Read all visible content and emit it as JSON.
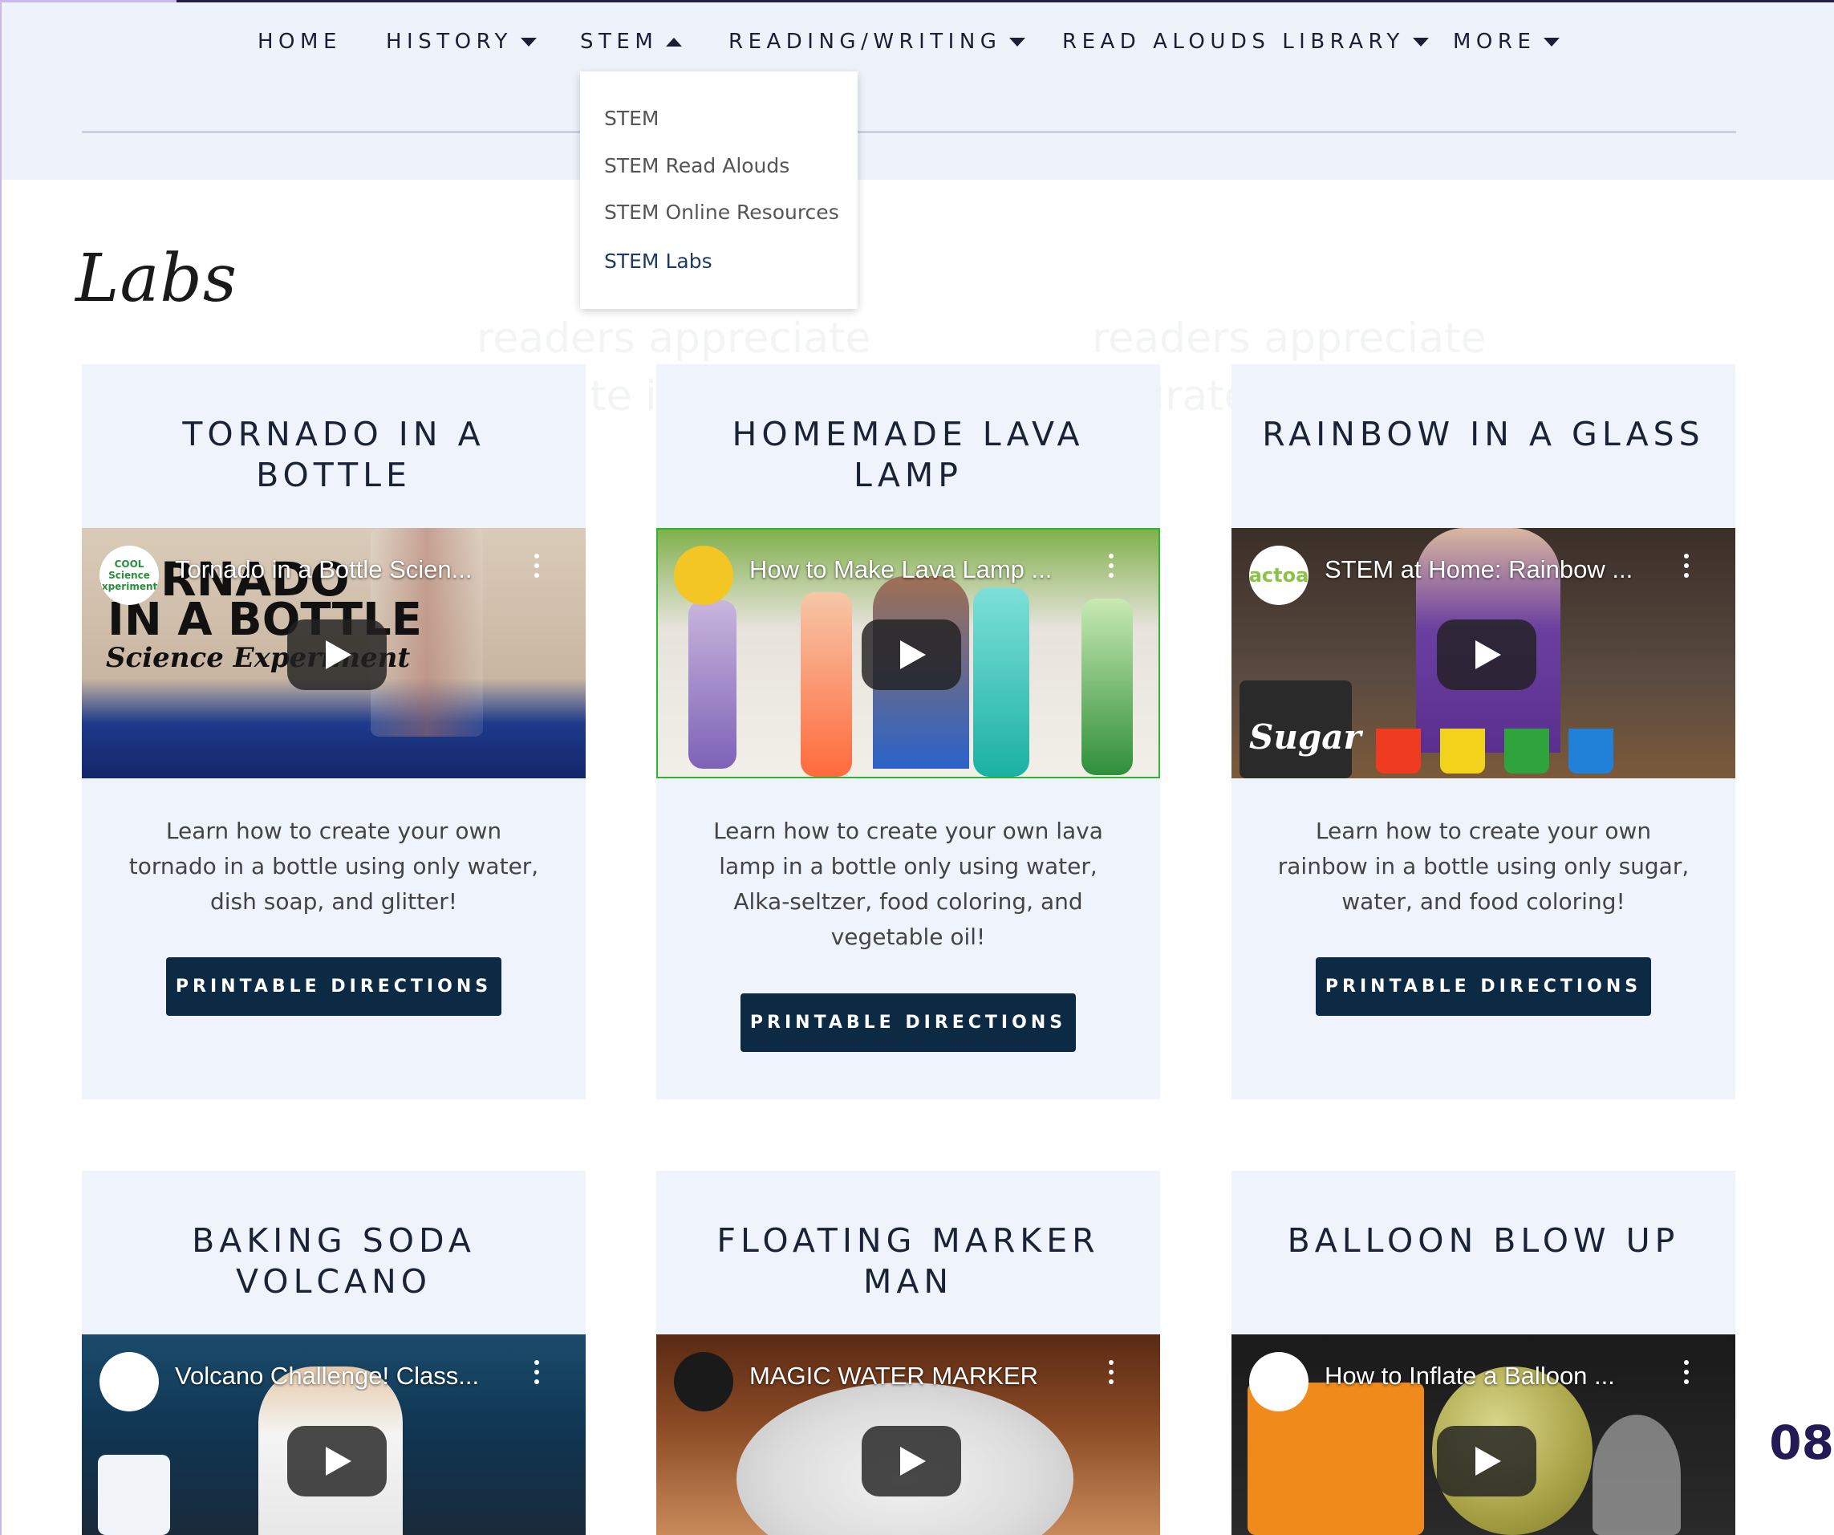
{
  "nav": {
    "home": "HOME",
    "history": "HISTORY",
    "stem": "STEM",
    "reading_writing": "READING/WRITING",
    "read_alouds_library": "READ ALOUDS LIBRARY",
    "more": "MORE"
  },
  "dropdown": {
    "items": [
      "STEM",
      "STEM Read Alouds",
      "STEM Online Resources",
      "STEM Labs"
    ]
  },
  "page": {
    "title": "Labs",
    "ghost_text": [
      "readers appreciate",
      "accurate information",
      "readers appreciate",
      "accurate information"
    ]
  },
  "cards": [
    {
      "title_line1": "TORNADO IN A",
      "title_line2": "BOTTLE",
      "video_title": "Tornado in a Bottle Scien...",
      "channel": "COOL Science Experiments",
      "overlay_text_1": "RNADO",
      "overlay_text_2": "IN A BOTTLE",
      "overlay_text_3": "Science Experiment",
      "desc_lines": [
        "Learn how to create your own",
        "tornado in a bottle using only water,",
        "dish soap, and glitter!"
      ],
      "button": "PRINTABLE DIRECTIONS"
    },
    {
      "title_line1": "HOMEMADE LAVA",
      "title_line2": "LAMP",
      "video_title": "How to Make Lava Lamp ...",
      "channel": "",
      "desc_lines": [
        "Learn how to create your own lava",
        "lamp in a bottle only using water,",
        "Alka-seltzer, food coloring, and",
        "vegetable oil!"
      ],
      "button": "PRINTABLE DIRECTIONS"
    },
    {
      "title_line1": "RAINBOW IN A GLASS",
      "title_line2": "",
      "video_title": "STEM at Home: Rainbow ...",
      "channel": "actoa",
      "overlay_text_1": "Sugar",
      "desc_lines": [
        "Learn how to create your own",
        "rainbow in a bottle using only sugar,",
        "water, and food coloring!"
      ],
      "button": "PRINTABLE DIRECTIONS"
    },
    {
      "title_line1": "BAKING SODA",
      "title_line2": "VOLCANO",
      "video_title": "Volcano Challenge! Class...",
      "channel": ""
    },
    {
      "title_line1": "FLOATING MARKER",
      "title_line2": "MAN",
      "video_title": "MAGIC WATER MARKER",
      "channel": ""
    },
    {
      "title_line1": "BALLOON BLOW UP",
      "title_line2": "",
      "video_title": "How to Inflate a Balloon ...",
      "channel": ""
    }
  ],
  "page_number": "08",
  "colors": {
    "header_bg": "#eef2fb",
    "card_bg": "#eef3fc",
    "button_bg": "#0d2a45",
    "page_number": "#241a55"
  }
}
